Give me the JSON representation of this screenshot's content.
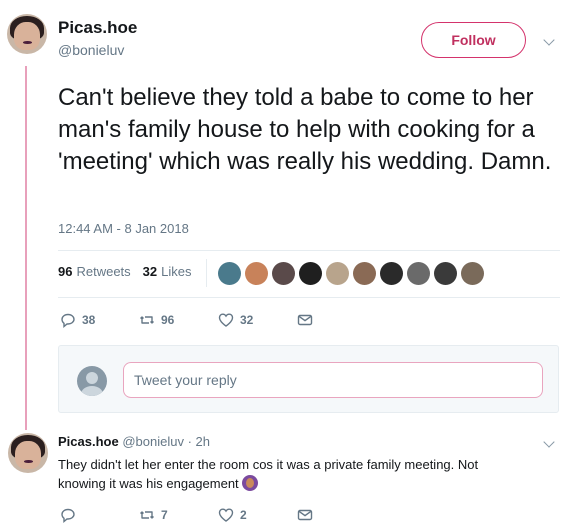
{
  "tweet": {
    "display_name": "Picas.hoe",
    "handle": "@bonieluv",
    "follow_label": "Follow",
    "text": "Can't believe they told a babe to come to her man's family house to help with cooking for a 'meeting' which was really his wedding. Damn.",
    "timestamp": "12:44 AM - 8 Jan 2018",
    "retweets_count": "96",
    "retweets_label": "Retweets",
    "likes_count": "32",
    "likes_label": "Likes",
    "actions": {
      "reply_count": "38",
      "retweet_count": "96",
      "like_count": "32"
    },
    "liker_colors": [
      "#4a7a8c",
      "#c8825a",
      "#5a4a4a",
      "#1f1f1f",
      "#b8a48c",
      "#8a6a55",
      "#2a2a2a",
      "#6a6a6a",
      "#3a3a3a",
      "#7a6a5a"
    ]
  },
  "reply_composer": {
    "placeholder": "Tweet your reply"
  },
  "reply": {
    "display_name": "Picas.hoe",
    "meta": "@bonieluv · 2h",
    "text": "They didn't let her enter the room cos it was a private family meeting. Not knowing it was his engagement",
    "actions": {
      "reply_count": "",
      "retweet_count": "7",
      "like_count": "2"
    }
  },
  "icons": [
    "reply-icon",
    "retweet-icon",
    "heart-icon",
    "message-icon",
    "chevron-down-icon",
    "user-icon"
  ],
  "colors": {
    "accent": "#c0305f",
    "thread_line": "#e8a0bb",
    "muted": "#657786"
  }
}
